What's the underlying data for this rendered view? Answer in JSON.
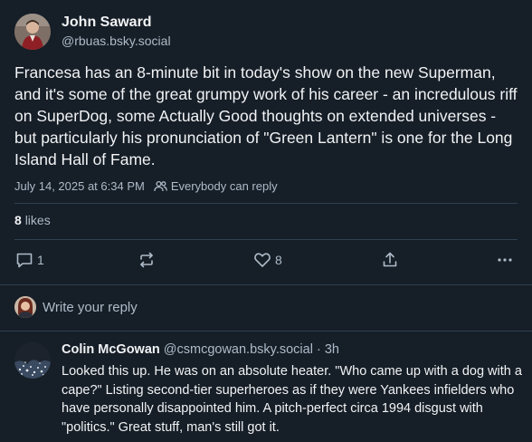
{
  "post": {
    "author_name": "John Saward",
    "author_handle": "@rbuas.bsky.social",
    "text": "Francesa has an 8-minute bit in today's show on the new Superman, and it's some of the great grumpy work of his career - an incredulous riff on SuperDog, some Actually Good thoughts on extended universes - but particularly his pronunciation of \"Green Lantern\" is one for the Long Island Hall of Fame.",
    "timestamp": "July 14, 2025 at 6:34 PM",
    "visibility": "Everybody can reply",
    "like_count": "8",
    "like_label": "likes"
  },
  "actions": {
    "reply_count": "1",
    "repost_count": "",
    "like_count": "8",
    "icons": [
      "comment-icon",
      "repost-icon",
      "heart-icon",
      "share-icon",
      "more-icon"
    ]
  },
  "reply_box": {
    "placeholder": "Write your reply"
  },
  "reply": {
    "author_name": "Colin McGowan",
    "author_handle": "@csmcgowan.bsky.social",
    "separator": "·",
    "time": "3h",
    "text": "Looked this up. He was on an absolute heater. \"Who came up with a dog with a cape?\" Listing second-tier superheroes as if they were Yankees infielders who have personally disappointed him. A pitch-perfect circa 1994 disgust with \"politics.\" Great stuff, man's still got it."
  },
  "colors": {
    "background": "#161e27",
    "text": "#f1f3f5",
    "muted": "#aebbc9",
    "divider": "#2e4052"
  }
}
